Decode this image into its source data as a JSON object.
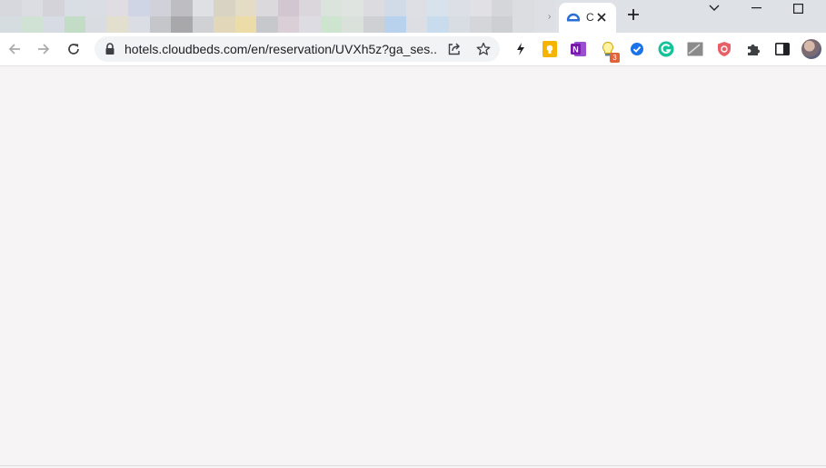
{
  "window": {
    "tab_strip_note_pixelated": true,
    "tabs": [
      {
        "title": "C",
        "active": true,
        "favicon": "cloudbeds-icon"
      }
    ],
    "tab_separator": "›",
    "new_tab_symbol": "+"
  },
  "toolbar": {
    "url": "hotels.cloudbeds.com/en/reservation/UVXh5z?ga_ses...",
    "extensions": [
      {
        "name": "lightning-extension-icon"
      },
      {
        "name": "google-keep-icon"
      },
      {
        "name": "onenote-icon",
        "label": "N"
      },
      {
        "name": "lightbulb-extension-icon",
        "badge": "3"
      },
      {
        "name": "checkmark-extension-icon"
      },
      {
        "name": "grammarly-icon"
      },
      {
        "name": "image-extension-icon"
      },
      {
        "name": "shield-extension-icon"
      },
      {
        "name": "extensions-puzzle-icon"
      },
      {
        "name": "side-panel-icon"
      }
    ]
  },
  "colors": {
    "tab_strip": "#dee1e6",
    "page_background": "#f6f4f5",
    "cloudbeds_blue": "#2b6fd6"
  }
}
